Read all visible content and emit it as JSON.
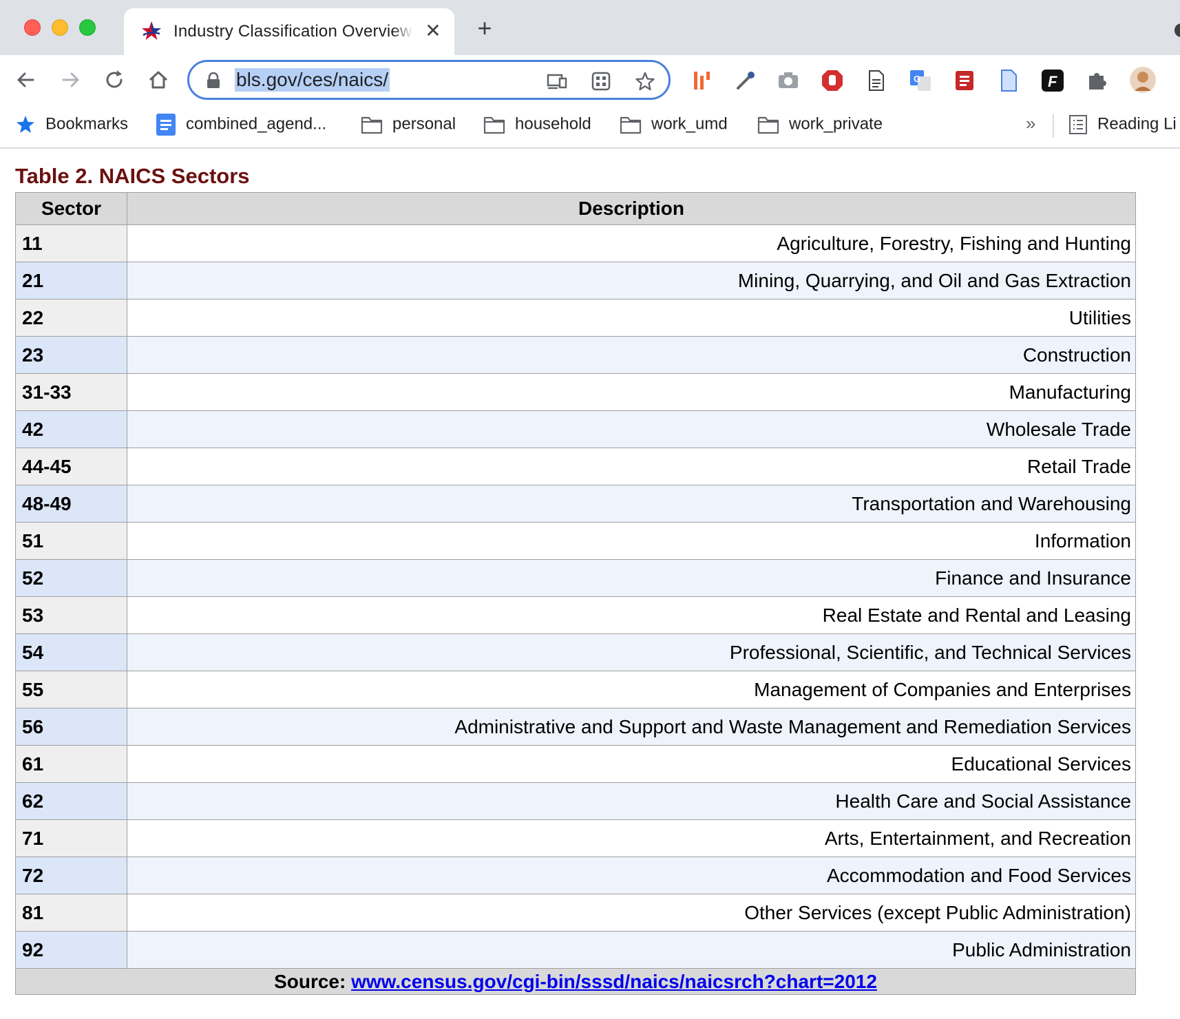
{
  "browser": {
    "tab": {
      "title": "Industry Classification Overview"
    },
    "address_bar": {
      "url": "bls.gov/ces/naics/"
    },
    "bookmarks": [
      {
        "label": "Bookmarks",
        "icon": "star-icon"
      },
      {
        "label": "combined_agend...",
        "icon": "docs-icon"
      },
      {
        "label": "personal",
        "icon": "folder-icon"
      },
      {
        "label": "household",
        "icon": "folder-icon"
      },
      {
        "label": "work_umd",
        "icon": "folder-icon"
      },
      {
        "label": "work_private",
        "icon": "folder-icon"
      }
    ],
    "bookmarks_overflow": "»",
    "reading_list": "Reading Li"
  },
  "page": {
    "caption": "Table 2. NAICS Sectors",
    "table": {
      "headers": [
        "Sector",
        "Description"
      ],
      "rows": [
        {
          "sector": "11",
          "description": "Agriculture, Forestry, Fishing and Hunting"
        },
        {
          "sector": "21",
          "description": "Mining, Quarrying, and Oil and Gas Extraction"
        },
        {
          "sector": "22",
          "description": "Utilities"
        },
        {
          "sector": "23",
          "description": "Construction"
        },
        {
          "sector": "31-33",
          "description": "Manufacturing"
        },
        {
          "sector": "42",
          "description": "Wholesale Trade"
        },
        {
          "sector": "44-45",
          "description": "Retail Trade"
        },
        {
          "sector": "48-49",
          "description": "Transportation and Warehousing"
        },
        {
          "sector": "51",
          "description": "Information"
        },
        {
          "sector": "52",
          "description": "Finance and Insurance"
        },
        {
          "sector": "53",
          "description": "Real Estate and Rental and Leasing"
        },
        {
          "sector": "54",
          "description": "Professional, Scientific, and Technical Services"
        },
        {
          "sector": "55",
          "description": "Management of Companies and Enterprises"
        },
        {
          "sector": "56",
          "description": "Administrative and Support and Waste Management and Remediation Services"
        },
        {
          "sector": "61",
          "description": "Educational Services"
        },
        {
          "sector": "62",
          "description": "Health Care and Social Assistance"
        },
        {
          "sector": "71",
          "description": "Arts, Entertainment, and Recreation"
        },
        {
          "sector": "72",
          "description": "Accommodation and Food Services"
        },
        {
          "sector": "81",
          "description": "Other Services (except Public Administration)"
        },
        {
          "sector": "92",
          "description": "Public Administration"
        }
      ],
      "source_label": "Source:",
      "source_link": "www.census.gov/cgi-bin/sssd/naics/naicsrch?chart=2012"
    }
  }
}
